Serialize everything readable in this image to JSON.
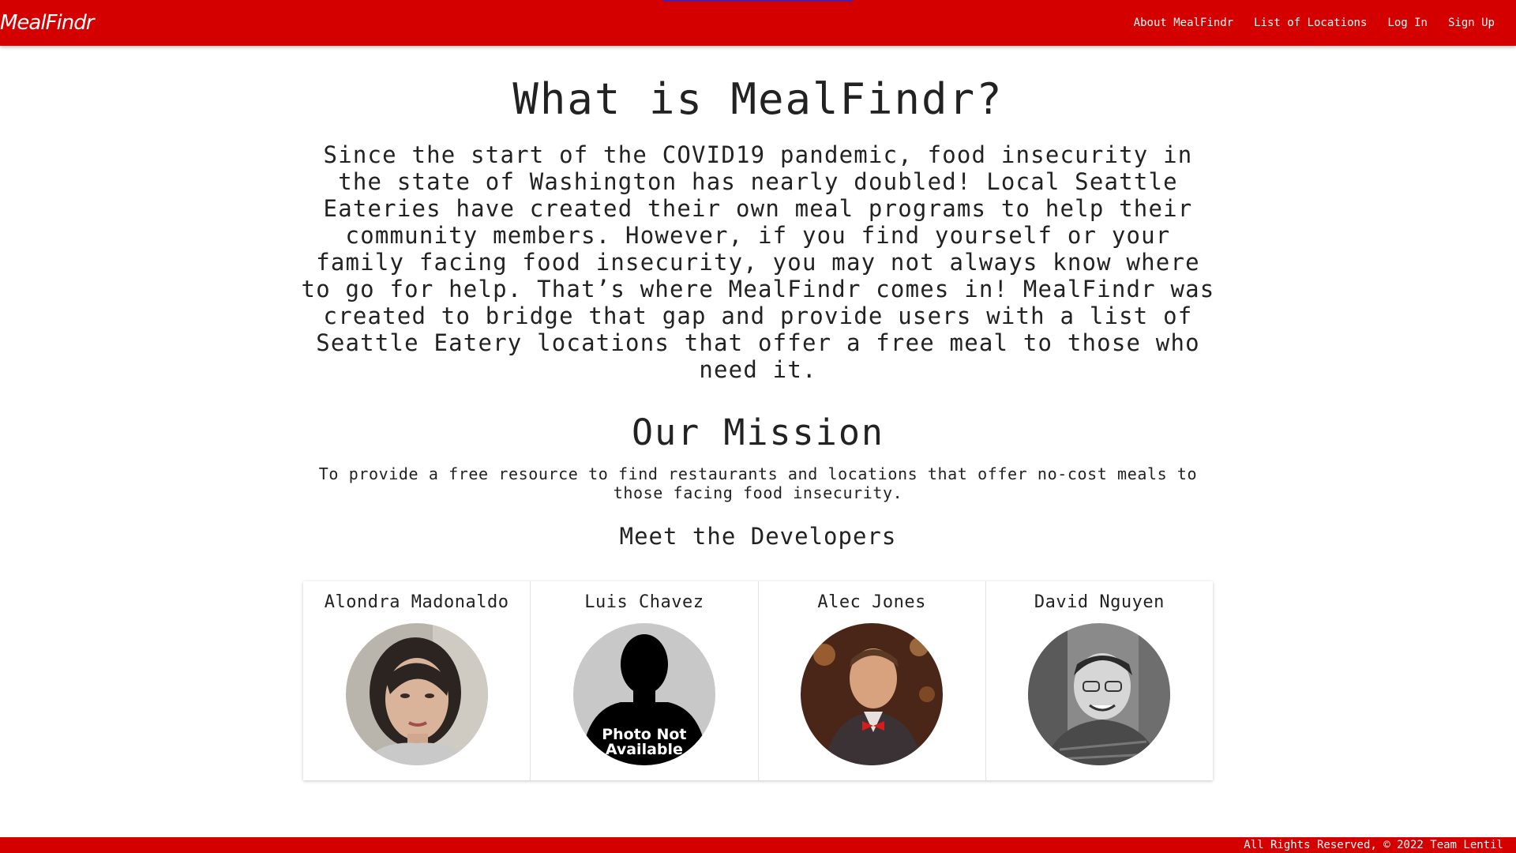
{
  "header": {
    "brand": "MealFindr",
    "nav": [
      {
        "label": "About MealFindr"
      },
      {
        "label": "List of Locations"
      },
      {
        "label": "Log In"
      },
      {
        "label": "Sign Up"
      }
    ]
  },
  "about": {
    "title": "What is MealFindr?",
    "intro": "Since the start of the COVID19 pandemic, food insecurity in the state of Washington has nearly doubled! Local Seattle Eateries have created their own meal programs to help their community members. However, if you find yourself or your family facing food insecurity, you may not always know where to go for help. That’s where MealFindr comes in! MealFindr was created to bridge that gap and provide users with a list of Seattle Eatery locations that offer a free meal to those who need it."
  },
  "mission": {
    "title": "Our Mission",
    "text": "To provide a free resource to find restaurants and locations that offer no-cost meals to those facing food insecurity."
  },
  "developers": {
    "title": "Meet the Developers",
    "people": [
      {
        "name": "Alondra Madonaldo"
      },
      {
        "name": "Luis Chavez",
        "photo_placeholder": "Photo Not Available"
      },
      {
        "name": "Alec Jones"
      },
      {
        "name": "David Nguyen"
      }
    ]
  },
  "footer": {
    "text": "All Rights Reserved, © 2022 Team Lentil"
  },
  "colors": {
    "brand_red": "#d40000",
    "text": "#222222",
    "background": "#ffffff"
  }
}
